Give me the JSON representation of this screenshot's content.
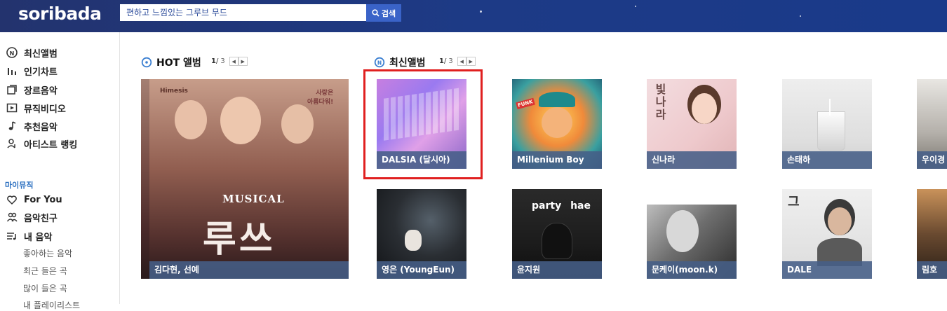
{
  "header": {
    "logo": "soribada",
    "search_value": "편하고 느낌있는 그루브 무드",
    "search_button": "검색"
  },
  "sidebar": {
    "items": [
      {
        "label": "최신앨범",
        "icon": "new-album-icon"
      },
      {
        "label": "인기차트",
        "icon": "chart-icon"
      },
      {
        "label": "장르음악",
        "icon": "genre-icon"
      },
      {
        "label": "뮤직비디오",
        "icon": "video-icon"
      },
      {
        "label": "추천음악",
        "icon": "music-note-icon"
      },
      {
        "label": "아티스트 랭킹",
        "icon": "artist-ranking-icon"
      }
    ],
    "my_music_heading": "마이뮤직",
    "my_items": [
      {
        "label": "For You",
        "icon": "heart-icon"
      },
      {
        "label": "음악친구",
        "icon": "friends-icon"
      },
      {
        "label": "내 음악",
        "icon": "playlist-icon"
      }
    ],
    "sub_items": [
      "좋아하는 음악",
      "최근 들은 곡",
      "많이 들은 곡",
      "내 플레이리스트"
    ]
  },
  "hot": {
    "title": "HOT 앨범",
    "page": "1",
    "slash": "/",
    "total": "3",
    "album": {
      "caption": "김다현, 선예",
      "art_title": "MUSICAL",
      "art_big": "루쓰",
      "art_logo": "Himesis",
      "art_tag": "사랑은\n아름다워!"
    }
  },
  "latest": {
    "title": "최신앨범",
    "page": "1",
    "slash": "/",
    "total": "3",
    "albums": [
      {
        "caption": "DALSIA (달시아)"
      },
      {
        "caption": "Millenium Boy",
        "art_text": "FUNK"
      },
      {
        "caption": "신나라",
        "art_text": "빛나라"
      },
      {
        "caption": "손태하"
      },
      {
        "caption": "우이경"
      },
      {
        "caption": "영은 (YoungEun)"
      },
      {
        "caption": "윤지원",
        "art_text": "party hae"
      },
      {
        "caption": "문케이(moon.k)"
      },
      {
        "caption": "DALE",
        "art_text": "그"
      },
      {
        "caption": "림호"
      }
    ]
  },
  "colors": {
    "header_bg": "#1d3a86",
    "accent": "#3a63c8",
    "highlight": "#e02020"
  }
}
